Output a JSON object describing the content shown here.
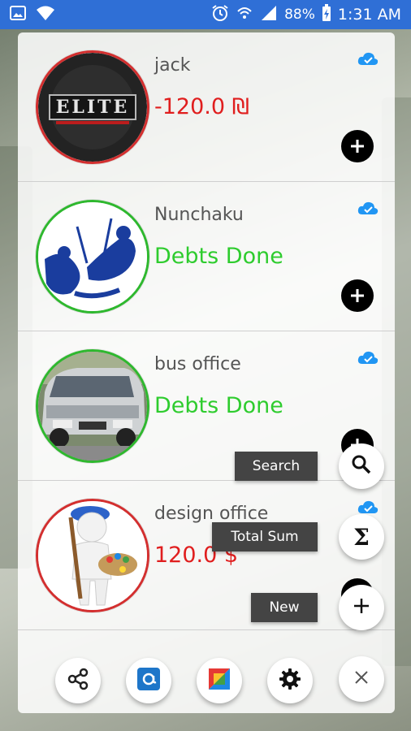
{
  "status_bar": {
    "battery": "88%",
    "time": "1:31 AM"
  },
  "contacts": [
    {
      "name": "jack",
      "amount": "-120.0 ₪",
      "status": "debt"
    },
    {
      "name": "Nunchaku",
      "amount": "Debts Done",
      "status": "done"
    },
    {
      "name": "bus office",
      "amount": "Debts Done",
      "status": "done"
    },
    {
      "name": "design office",
      "amount": "120.0 $",
      "status": "debt"
    }
  ],
  "avatar_text": {
    "jack_logo": "ELITE"
  },
  "fab_menu": {
    "search_label": "Search",
    "total_label": "Total Sum",
    "new_label": "New"
  },
  "icons": {
    "status_left": [
      "gallery-icon",
      "wifi-icon"
    ],
    "status_right": [
      "alarm-icon",
      "wifi-calling-icon",
      "signal-icon",
      "battery-icon"
    ],
    "row_cloud": "cloud-sync-icon",
    "row_add": "add-circle-icon",
    "bottom": [
      "share-icon",
      "email-icon",
      "play-store-icon",
      "settings-icon",
      "close-icon"
    ],
    "fabs": [
      "search-icon",
      "sigma-icon",
      "plus-icon"
    ]
  },
  "colors": {
    "status_bar": "#2f6fd6",
    "debt_red": "#e01e1e",
    "done_green": "#2ecc2e",
    "cloud_blue": "#2196f3"
  }
}
